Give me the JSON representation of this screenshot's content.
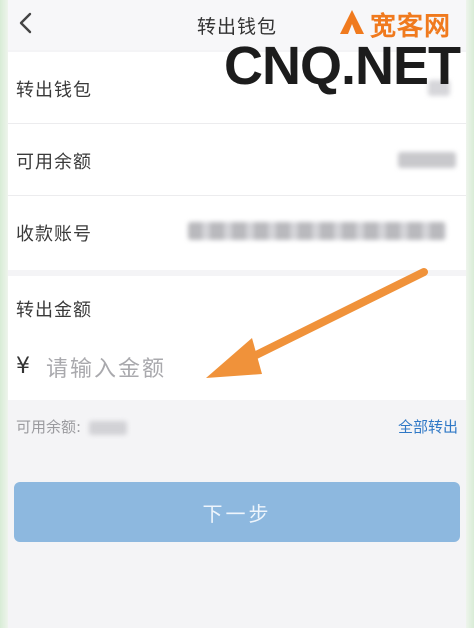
{
  "header": {
    "title": "转出钱包",
    "back_icon": "chevron-left-icon"
  },
  "details": {
    "rows": [
      {
        "label": "转出钱包"
      },
      {
        "label": "可用余额"
      },
      {
        "label": "收款账号"
      }
    ]
  },
  "amount": {
    "label": "转出金额",
    "currency_symbol": "¥",
    "input_value": "",
    "placeholder": "请输入金额"
  },
  "available": {
    "label": "可用余额:",
    "transfer_all_label": "全部转出"
  },
  "next_button": {
    "label": "下一步"
  },
  "watermark": {
    "cn_text": "宽客网",
    "en_text": "CNQ.NET"
  },
  "colors": {
    "accent_blue": "#2f78c6",
    "button_bg": "#8db8df",
    "arrow_orange": "#f0923a",
    "watermark_orange": "#f07a1e"
  }
}
